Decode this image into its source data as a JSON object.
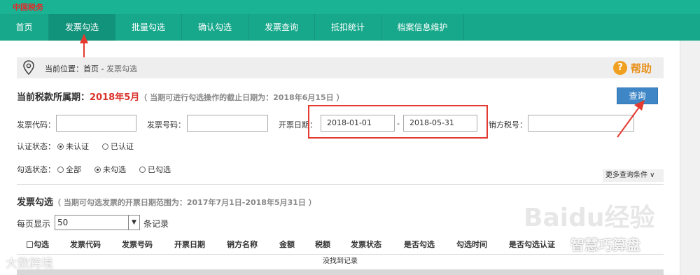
{
  "brand": {
    "logo_text": "中国税务"
  },
  "nav": {
    "items": [
      {
        "label": "首页"
      },
      {
        "label": "发票勾选"
      },
      {
        "label": "批量勾选"
      },
      {
        "label": "确认勾选"
      },
      {
        "label": "发票查询"
      },
      {
        "label": "抵扣统计"
      },
      {
        "label": "档案信息维护"
      }
    ]
  },
  "breadcrumb": {
    "prefix": "当前位置：首页 - ",
    "current": "发票勾选"
  },
  "help": {
    "label": "帮助"
  },
  "period": {
    "label": "当前税款所属期：",
    "month": "2018年5月",
    "note": "（ 当期可进行勾选操作的截止日期为：2018年6月15日 ）"
  },
  "query_button": "查询",
  "filters": {
    "invoice_code_label": "发票代码：",
    "invoice_code_value": "",
    "invoice_number_label": "发票号码：",
    "invoice_number_value": "",
    "date_label": "开票日期：",
    "date_from": "2018-01-01",
    "date_sep": "-",
    "date_to": "2018-05-31",
    "seller_tax_label": "销方税号：",
    "seller_tax_value": "",
    "auth_label": "认证状态：",
    "auth_options": [
      {
        "label": "未认证",
        "selected": true
      },
      {
        "label": "已认证",
        "selected": false
      }
    ],
    "check_label": "勾选状态：",
    "check_options": [
      {
        "label": "全部",
        "selected": false
      },
      {
        "label": "未勾选",
        "selected": true
      },
      {
        "label": "已勾选",
        "selected": false
      }
    ],
    "more_conditions": "更多查询条件 ∨"
  },
  "section": {
    "title": "发票勾选",
    "note": "（ 当期可勾选发票的开票日期范围为：2017年7月1日-2018年5月31日 ）"
  },
  "pagination": {
    "label": "每页显示",
    "value": "50",
    "suffix": "条记录"
  },
  "table": {
    "columns": [
      "勾选",
      "发票代码",
      "发票号码",
      "开票日期",
      "销方名称",
      "金额",
      "税额",
      "发票状态",
      "是否勾选",
      "勾选时间",
      "是否勾选认证"
    ],
    "empty_text": "没找到记录"
  },
  "watermarks": {
    "left": "大数跨境",
    "right": "智慧巧算盘",
    "baidu": "Baidu经验"
  },
  "colors": {
    "nav_bg": "#17a88b",
    "accent_red": "#e53a2f",
    "button_blue": "#3f86c7",
    "help_orange": "#e8901a"
  }
}
